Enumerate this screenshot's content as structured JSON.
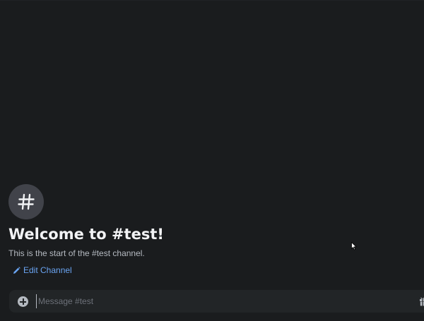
{
  "channel": {
    "name": "#test",
    "welcome_title": "Welcome to #test!",
    "welcome_desc": "This is the start of the #test channel.",
    "avatar_icon": "hashtag-icon"
  },
  "actions": {
    "edit_channel_label": "Edit Channel",
    "edit_icon": "pencil-icon"
  },
  "composer": {
    "placeholder": "Message #test",
    "value": "",
    "add_icon": "plus-circle-icon",
    "gift_icon": "gift-icon"
  },
  "colors": {
    "background": "#1a1c1e",
    "composer_bg": "#222527",
    "link": "#6aa4f2",
    "title": "#f2f3f5",
    "muted": "#b5bac1"
  }
}
